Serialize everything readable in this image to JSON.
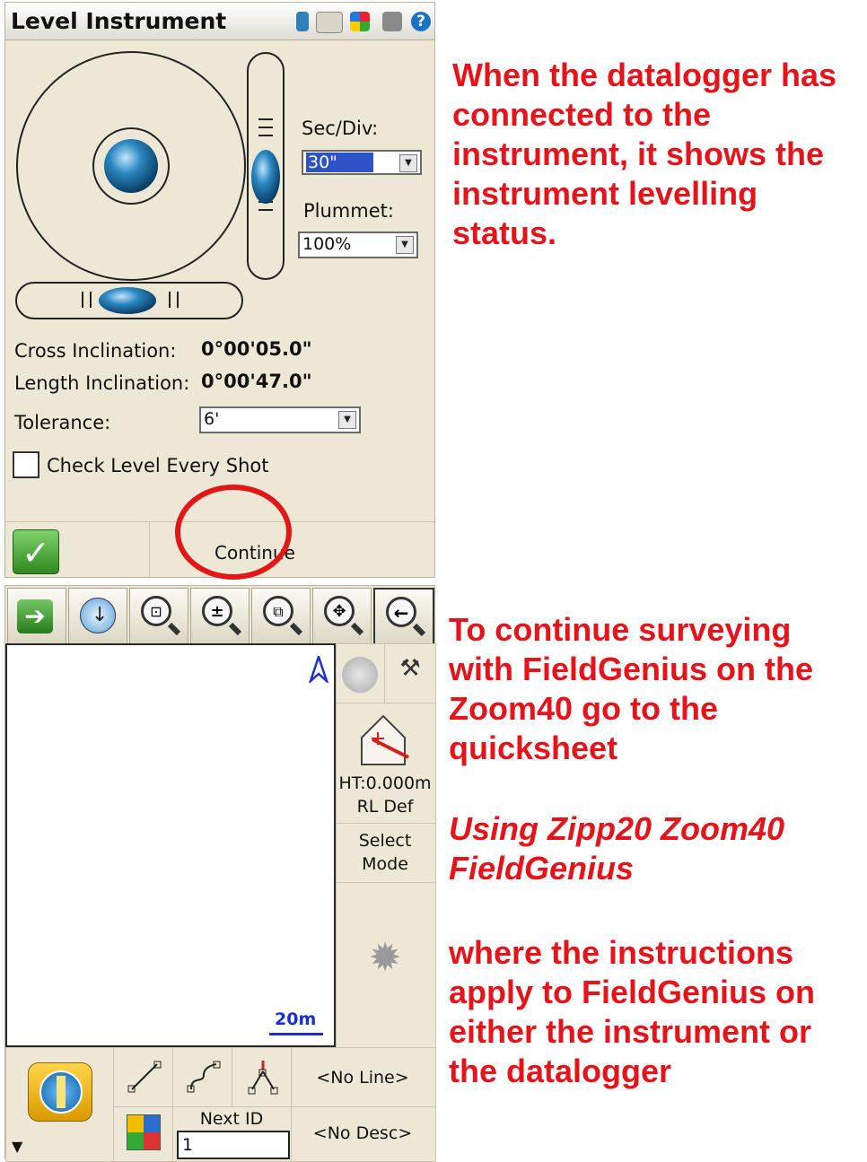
{
  "level_instrument": {
    "title": "Level Instrument",
    "sec_div": {
      "label": "Sec/Div:",
      "value": "30\""
    },
    "plummet": {
      "label": "Plummet:",
      "value": "100%"
    },
    "cross_inclination": {
      "label": "Cross Inclination:",
      "value": "0°00'05.0\""
    },
    "length_inclination": {
      "label": "Length Inclination:",
      "value": "0°00'47.0\""
    },
    "tolerance": {
      "label": "Tolerance:",
      "value": "6'"
    },
    "check_level": {
      "label": "Check Level Every Shot",
      "checked": false
    },
    "continue_label": "Continue"
  },
  "map_screen": {
    "scale_label": "20m",
    "ht_label": "HT:0.000m",
    "rl_label": "RL Def",
    "select_mode": [
      "Select",
      "Mode"
    ],
    "no_line": "<No Line>",
    "next_id_label": "Next ID",
    "next_id_value": "1",
    "no_desc": "<No Desc>"
  },
  "annotations": {
    "top": [
      "When the datalogger has",
      "connected to the",
      "instrument, it shows the",
      "instrument levelling",
      "status."
    ],
    "bottom_1": [
      "To continue surveying",
      "with FieldGenius on the",
      "Zoom40 go to the",
      "quicksheet"
    ],
    "bottom_2": [
      "Using Zipp20 Zoom40",
      "FieldGenius"
    ],
    "bottom_3": [
      "where the instructions",
      "apply to FieldGenius on",
      "either the instrument or",
      "the datalogger"
    ]
  },
  "colors": {
    "annotation": "#e5141b",
    "bubble": "#1e6fa5",
    "highlight_circle": "#e01818",
    "ok_green": "#3a9a2a"
  }
}
